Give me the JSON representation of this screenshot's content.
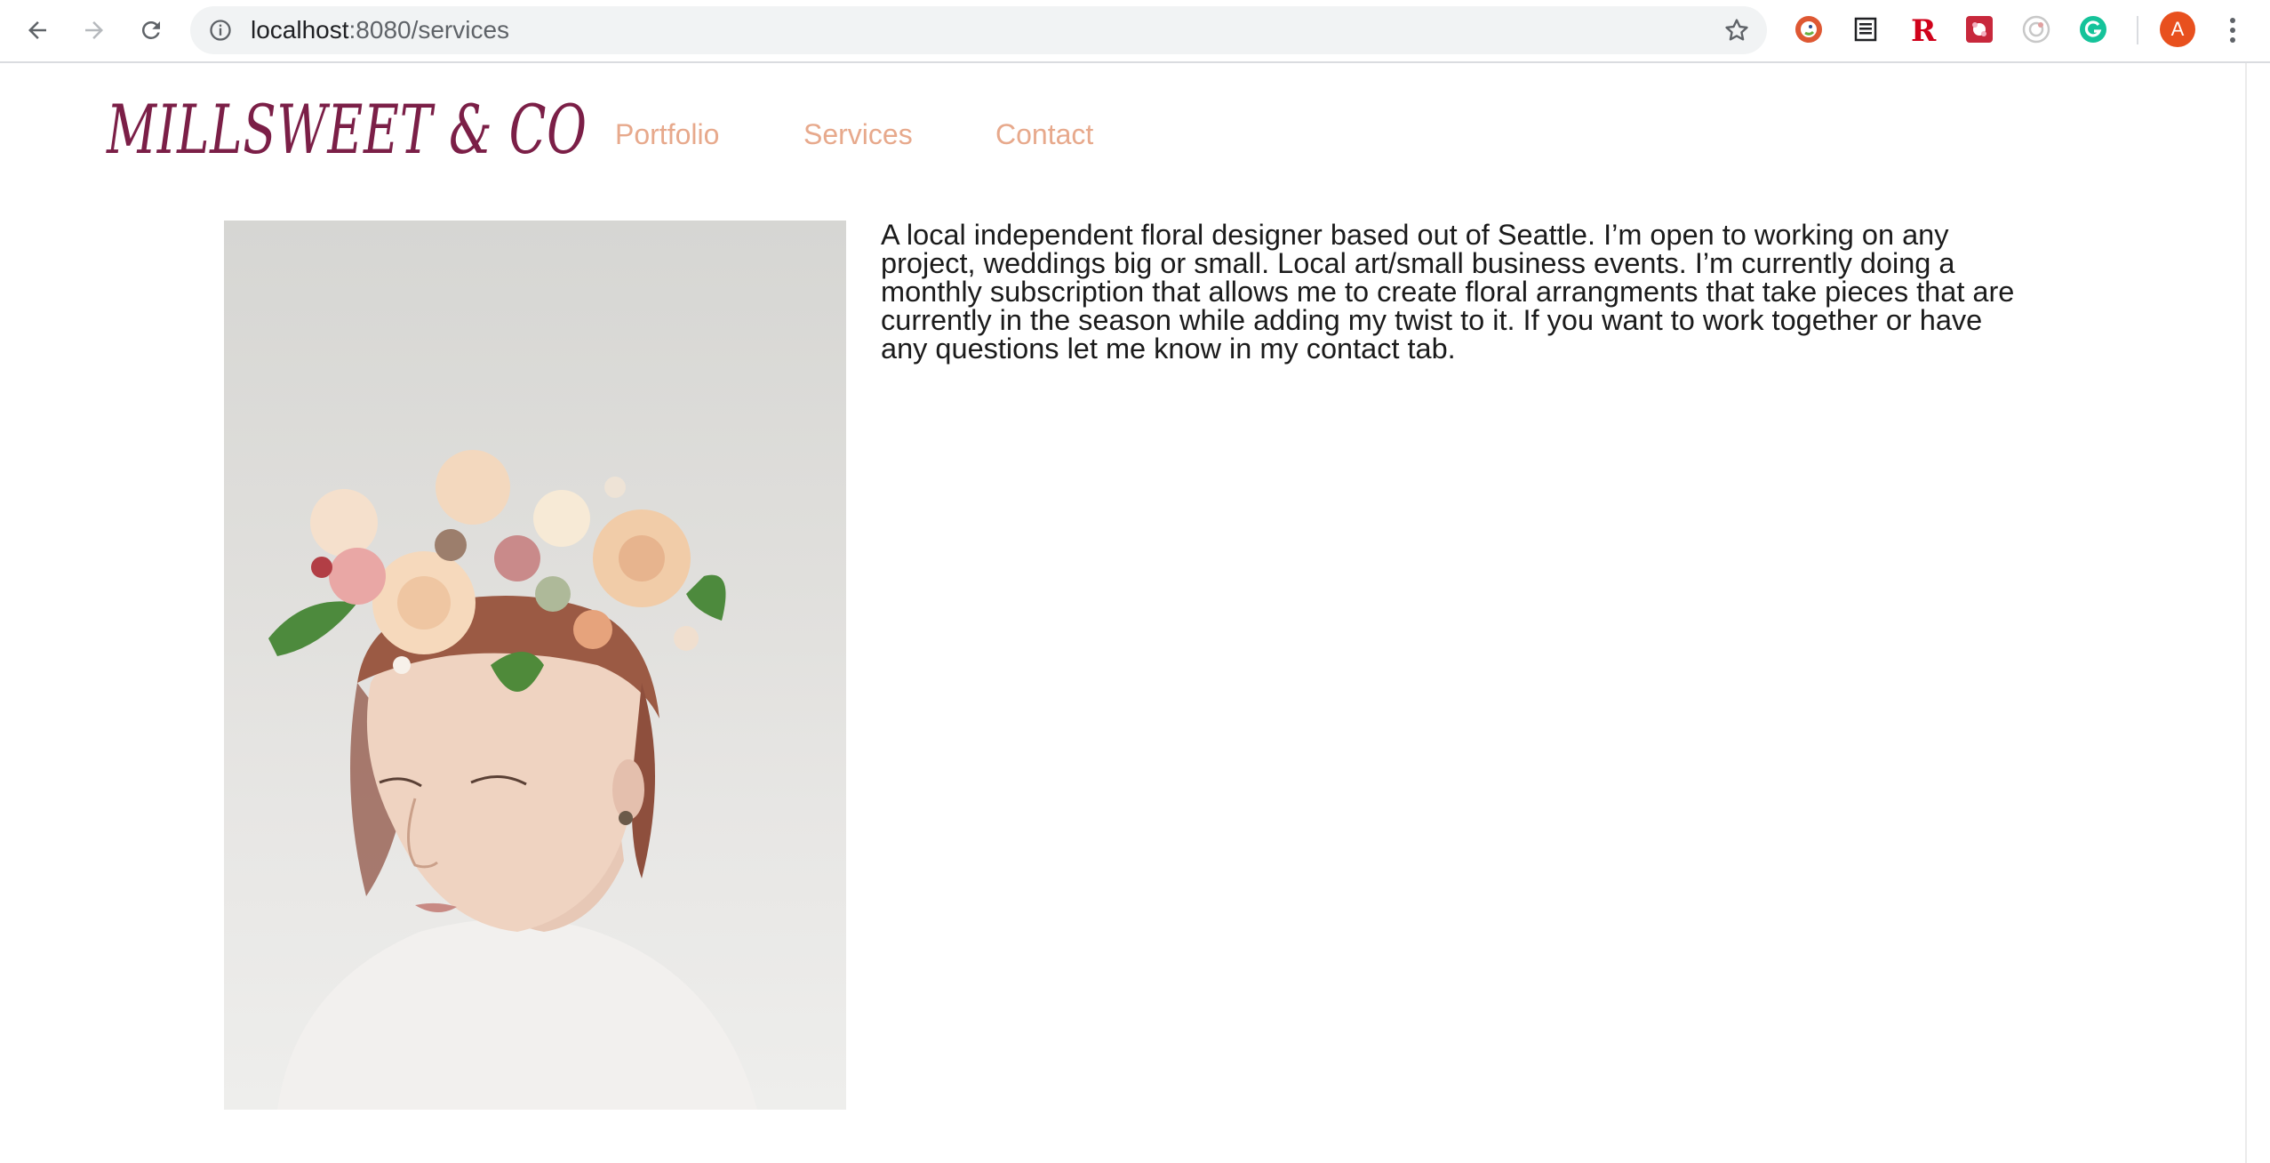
{
  "browser": {
    "url_host": "localhost",
    "url_path": ":8080/services",
    "avatar_letter": "A"
  },
  "site": {
    "logo": "MILLSWEET & CO",
    "nav": [
      {
        "label": "Portfolio"
      },
      {
        "label": "Services"
      },
      {
        "label": "Contact"
      }
    ],
    "blurb": "A local independent floral designer based out of Seattle. I’m open to working on any project, weddings big or small. Local art/small business events. I’m currently doing a monthly subscription that allows me to create floral arrangments that take pieces that are currently in the season while adding my twist to it. If you want to work together or have any questions let me know in my contact tab."
  },
  "colors": {
    "logo": "#7b1f47",
    "nav": "#e7a98c",
    "text": "#1b1b1b"
  }
}
